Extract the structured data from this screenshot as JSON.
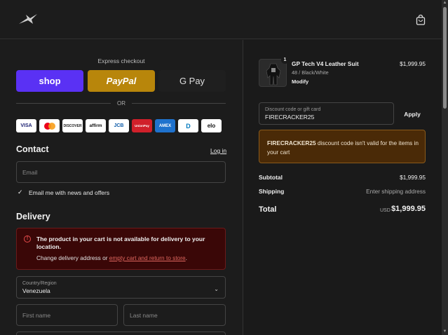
{
  "header": {
    "logo_icon": "alpinestars-star-logo",
    "cart_icon": "shopping-bag-icon"
  },
  "express": {
    "title": "Express checkout",
    "shop_label": "shop",
    "paypal_label": "PayPal",
    "gpay_label": "G Pay",
    "or_label": "OR"
  },
  "payment_cards": [
    "VISA",
    "MC",
    "DISCOVER",
    "affirm",
    "JCB",
    "UnionPay",
    "AMEX",
    "D",
    "elo"
  ],
  "contact": {
    "title": "Contact",
    "login_label": "Log in",
    "email_placeholder": "Email",
    "news_label": "Email me with news and offers"
  },
  "delivery": {
    "title": "Delivery",
    "error_title": "The product in your cart is not available for delivery to your location.",
    "error_desc_prefix": "Change delivery address or ",
    "error_link": "empty cart and return to store",
    "error_desc_suffix": ".",
    "country_label": "Country/Region",
    "country_value": "Venezuela",
    "first_name_placeholder": "First name",
    "last_name_placeholder": "Last name"
  },
  "order": {
    "product_name": "GP Tech V4 Leather Suit",
    "product_variant": "48 / Black/White",
    "modify_label": "Modify",
    "product_price": "$1,999.95",
    "quantity": "1",
    "discount_label": "Discount code or gift card",
    "discount_value": "FIRECRACKER25",
    "apply_label": "Apply",
    "warning_code": "FIRECRACKER25",
    "warning_text": " discount code isn't valid for the items in your cart",
    "subtotal_label": "Subtotal",
    "subtotal_value": "$1,999.95",
    "shipping_label": "Shipping",
    "shipping_value": "Enter shipping address",
    "total_label": "Total",
    "total_currency": "USD",
    "total_value": "$1,999.95"
  },
  "colors": {
    "shop": "#5a31f4",
    "paypal": "#b8860b",
    "error_bg": "#3a0707",
    "warning_bg": "#4a2a07"
  }
}
